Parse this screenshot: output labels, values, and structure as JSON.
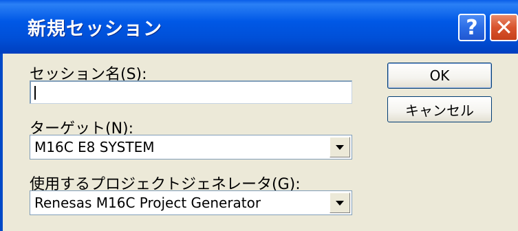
{
  "dialog": {
    "title": "新規セッション",
    "help_glyph": "?",
    "close_glyph": "✕"
  },
  "session_name": {
    "label": "セッション名(S):",
    "value": ""
  },
  "target": {
    "label": "ターゲット(N):",
    "selected": "M16C E8 SYSTEM"
  },
  "generator": {
    "label": "使用するプロジェクトジェネレータ(G):",
    "selected": "Renesas M16C Project Generator"
  },
  "buttons": {
    "ok": "OK",
    "cancel": "キャンセル"
  },
  "icons": {
    "help": "help-icon",
    "close": "close-icon",
    "dropdown": "chevron-down-icon"
  },
  "colors": {
    "titlebar": "#0058e6",
    "close_button": "#d9542e",
    "dialog_face": "#ece9d8"
  }
}
